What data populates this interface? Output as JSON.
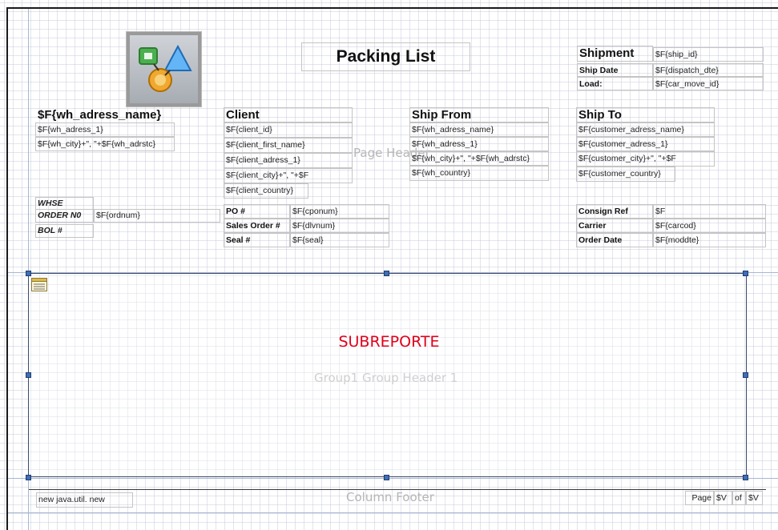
{
  "title": "Packing List",
  "page_header_band": "Page Header",
  "group_header_band": "Group1 Group Header 1",
  "column_footer_band": "Column Footer",
  "subreport_label": "SUBREPORTE",
  "warehouse": {
    "name": "$F{wh_adress_name}",
    "address1": "$F{wh_adress_1}",
    "city": "$F{wh_city}+\", \"+$F{wh_adrstc}"
  },
  "shipment": {
    "heading": "Shipment",
    "ship_id": "$F{ship_id}",
    "ship_date_label": "Ship Date",
    "ship_date": "$F{dispatch_dte}",
    "load_label": "Load:",
    "load": "$F{car_move_id}"
  },
  "client": {
    "heading": "Client",
    "lines": [
      "$F{client_id}",
      "$F{client_first_name}",
      "$F{client_adress_1}",
      "$F{client_city}+\", \"+$F",
      "$F{client_country}"
    ]
  },
  "ship_from": {
    "heading": "Ship From",
    "lines": [
      "$F{wh_adress_name}",
      "$F{wh_adress_1}",
      "$F{wh_city}+\", \"+$F{wh_adrstc}",
      "$F{wh_country}"
    ]
  },
  "ship_to": {
    "heading": "Ship To",
    "lines": [
      "$F{customer_adress_name}",
      "$F{customer_adress_1}",
      "$F{customer_city}+\", \"+$F",
      "$F{customer_country}"
    ]
  },
  "order": {
    "whse_label": "WHSE",
    "order_label": "ORDER N0",
    "ordnum": "$F{ordnum}",
    "bol_label": "BOL #"
  },
  "po": {
    "po_label": "PO #",
    "po_value": "$F{cponum}",
    "sales_label": "Sales Order #",
    "sales_value": "$F{dlvnum}",
    "seal_label": "Seal #",
    "seal_value": "$F{seal}"
  },
  "consign": {
    "consign_label": "Consign Ref",
    "consign_value": "$F",
    "carrier_label": "Carrier",
    "carrier_value": "$F{carcod}",
    "order_date_label": "Order Date",
    "order_date_value": "$F{moddte}"
  },
  "footer": {
    "date_expr": "new java.util.",
    "date_expr2": "new",
    "page_label": "Page",
    "page_var": "$V",
    "of_label": "of",
    "total_var": "$V"
  },
  "colors": {
    "subreport_text": "#e0001a",
    "band_label": "#b5b5b5",
    "handle": "#3d6fb6"
  }
}
